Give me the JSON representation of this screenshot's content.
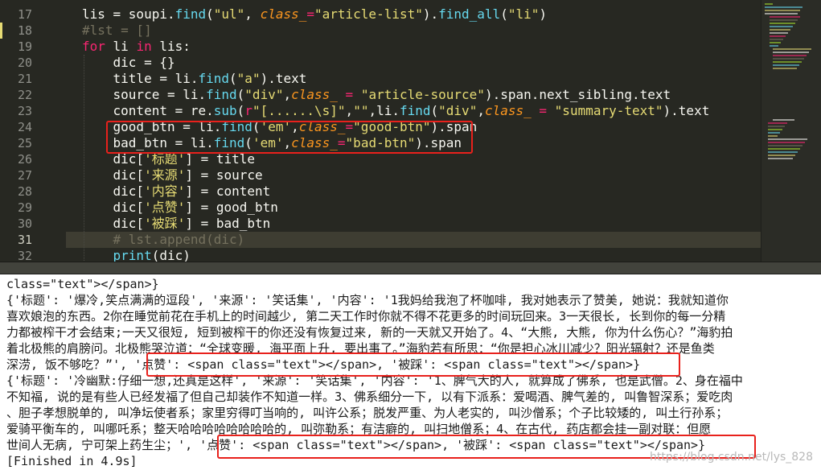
{
  "editor": {
    "current_line": "31",
    "lines": [
      {
        "num": "17",
        "tokens": [
          {
            "t": "lis = soupi.",
            "c": "t-name"
          },
          {
            "t": "find",
            "c": "t-fn"
          },
          {
            "t": "(",
            "c": "t-name"
          },
          {
            "t": "\"ul\"",
            "c": "t-str"
          },
          {
            "t": ", ",
            "c": "t-name"
          },
          {
            "t": "class_",
            "c": "t-param"
          },
          {
            "t": "=",
            "c": "t-op"
          },
          {
            "t": "\"article-list\"",
            "c": "t-str"
          },
          {
            "t": ").",
            "c": "t-name"
          },
          {
            "t": "find_all",
            "c": "t-fn"
          },
          {
            "t": "(",
            "c": "t-name"
          },
          {
            "t": "\"li\"",
            "c": "t-str"
          },
          {
            "t": ")",
            "c": "t-name"
          }
        ]
      },
      {
        "num": "18",
        "tokens": [
          {
            "t": "#lst = []",
            "c": "t-comment"
          }
        ]
      },
      {
        "num": "19",
        "tokens": [
          {
            "t": "for",
            "c": "t-kw"
          },
          {
            "t": " li ",
            "c": "t-name"
          },
          {
            "t": "in",
            "c": "t-kw"
          },
          {
            "t": " lis:",
            "c": "t-name"
          }
        ]
      },
      {
        "num": "20",
        "tokens": [
          {
            "t": "    dic = {}",
            "c": "t-name"
          }
        ]
      },
      {
        "num": "21",
        "tokens": [
          {
            "t": "    title = li.",
            "c": "t-name"
          },
          {
            "t": "find",
            "c": "t-fn"
          },
          {
            "t": "(",
            "c": "t-name"
          },
          {
            "t": "\"a\"",
            "c": "t-str"
          },
          {
            "t": ").text",
            "c": "t-name"
          }
        ]
      },
      {
        "num": "22",
        "tokens": [
          {
            "t": "    source = li.",
            "c": "t-name"
          },
          {
            "t": "find",
            "c": "t-fn"
          },
          {
            "t": "(",
            "c": "t-name"
          },
          {
            "t": "\"div\"",
            "c": "t-str"
          },
          {
            "t": ",",
            "c": "t-name"
          },
          {
            "t": "class_",
            "c": "t-param"
          },
          {
            "t": " = ",
            "c": "t-op"
          },
          {
            "t": "\"article-source\"",
            "c": "t-str"
          },
          {
            "t": ").span.next_sibling.text",
            "c": "t-name"
          }
        ]
      },
      {
        "num": "23",
        "tokens": [
          {
            "t": "    content = re.",
            "c": "t-name"
          },
          {
            "t": "sub",
            "c": "t-fn"
          },
          {
            "t": "(",
            "c": "t-name"
          },
          {
            "t": "r",
            "c": "t-kw"
          },
          {
            "t": "\"[......\\s]\"",
            "c": "t-str"
          },
          {
            "t": ",",
            "c": "t-name"
          },
          {
            "t": "\"\"",
            "c": "t-str"
          },
          {
            "t": ",li.",
            "c": "t-name"
          },
          {
            "t": "find",
            "c": "t-fn"
          },
          {
            "t": "(",
            "c": "t-name"
          },
          {
            "t": "\"div\"",
            "c": "t-str"
          },
          {
            "t": ",",
            "c": "t-name"
          },
          {
            "t": "class_",
            "c": "t-param"
          },
          {
            "t": " = ",
            "c": "t-op"
          },
          {
            "t": "\"summary-text\"",
            "c": "t-str"
          },
          {
            "t": ").text",
            "c": "t-name"
          }
        ]
      },
      {
        "num": "24",
        "tokens": [
          {
            "t": "    good_btn = li.",
            "c": "t-name"
          },
          {
            "t": "find",
            "c": "t-fn"
          },
          {
            "t": "(",
            "c": "t-name"
          },
          {
            "t": "'em'",
            "c": "t-str"
          },
          {
            "t": ",",
            "c": "t-name"
          },
          {
            "t": "class_",
            "c": "t-param"
          },
          {
            "t": "=",
            "c": "t-op"
          },
          {
            "t": "\"good-btn\"",
            "c": "t-str"
          },
          {
            "t": ").span",
            "c": "t-name"
          }
        ]
      },
      {
        "num": "25",
        "tokens": [
          {
            "t": "    bad_btn = li.",
            "c": "t-name"
          },
          {
            "t": "find",
            "c": "t-fn"
          },
          {
            "t": "(",
            "c": "t-name"
          },
          {
            "t": "'em'",
            "c": "t-str"
          },
          {
            "t": ",",
            "c": "t-name"
          },
          {
            "t": "class_",
            "c": "t-param"
          },
          {
            "t": "=",
            "c": "t-op"
          },
          {
            "t": "\"bad-btn\"",
            "c": "t-str"
          },
          {
            "t": ").span",
            "c": "t-name"
          }
        ]
      },
      {
        "num": "26",
        "tokens": [
          {
            "t": "    dic[",
            "c": "t-name"
          },
          {
            "t": "'标题'",
            "c": "t-str"
          },
          {
            "t": "] = title",
            "c": "t-name"
          }
        ]
      },
      {
        "num": "27",
        "tokens": [
          {
            "t": "    dic[",
            "c": "t-name"
          },
          {
            "t": "'来源'",
            "c": "t-str"
          },
          {
            "t": "] = source",
            "c": "t-name"
          }
        ]
      },
      {
        "num": "28",
        "tokens": [
          {
            "t": "    dic[",
            "c": "t-name"
          },
          {
            "t": "'内容'",
            "c": "t-str"
          },
          {
            "t": "] = content",
            "c": "t-name"
          }
        ]
      },
      {
        "num": "29",
        "tokens": [
          {
            "t": "    dic[",
            "c": "t-name"
          },
          {
            "t": "'点赞'",
            "c": "t-str"
          },
          {
            "t": "] = good_btn",
            "c": "t-name"
          }
        ]
      },
      {
        "num": "30",
        "tokens": [
          {
            "t": "    dic[",
            "c": "t-name"
          },
          {
            "t": "'被踩'",
            "c": "t-str"
          },
          {
            "t": "] = bad_btn",
            "c": "t-name"
          }
        ]
      },
      {
        "num": "31",
        "tokens": [
          {
            "t": "    # lst.append(dic)",
            "c": "t-comment"
          }
        ]
      },
      {
        "num": "32",
        "tokens": [
          {
            "t": "    ",
            "c": "t-name"
          },
          {
            "t": "print",
            "c": "t-fn"
          },
          {
            "t": "(dic)",
            "c": "t-name"
          }
        ]
      }
    ]
  },
  "console": {
    "lines": [
      "class=\"text\"></span>}",
      "{'标题': '爆冷,笑点满满的逗段', '来源': '笑话集', '内容': '1我妈给我泡了杯咖啡, 我对她表示了赞美, 她说：我就知道你",
      "喜欢娘泡的东西。2你在睡觉前花在手机上的时间越少, 第二天工作时你就不得不花更多的时间玩回来。3一天很长, 长到你的每一分精",
      "力都被榨干才会结束;一天又很短, 短到被榨干的你还没有恢复过来, 新的一天就又开始了。4、“大熊, 大熊, 你为什么伤心？”海豹拍",
      "着北极熊的肩膀问。北极熊哭泣道：“全球变暖, 海平面上升, 要出事了。”海豹若有所思：“你是担心冰川减少？阳光辐射？还是鱼类",
      "深涝, 饭不够吃？”', '点赞': <span class=\"text\"></span>, '被踩': <span class=\"text\"></span>}",
      "{'标题': '冷幽默:仔细一想,还真是这样', '来源': '笑话集', '内容': '1、脾气大的人, 就算成了佛系, 也是武僧。2、身在福中",
      "不知福, 说的是有些人已经发福了但自己却装作不知道一样。3、佛系细分一下, 以有下派系：爱喝酒、脾气差的, 叫鲁智深系；爱吃肉",
      "、胆子孝想脱单的, 叫净坛使者系；家里穷得叮当响的, 叫许公系；脱发严重、为人老实的, 叫沙僧系；个子比较矮的, 叫土行孙系；",
      "爱骑平衡车的, 叫哪吒系；整天哈哈哈哈哈哈哈哈的, 叫弥勒系；有洁癖的, 叫扫地僧系；4、在古代, 药店都会挂一副对联：但愿",
      "世间人无病, 宁可架上药生尘；', '点赞': <span class=\"text\"></span>, '被踩': <span class=\"text\"></span>}",
      "[Finished in 4.9s]"
    ]
  },
  "watermark": "https://blog.csdn.net/lys_828"
}
